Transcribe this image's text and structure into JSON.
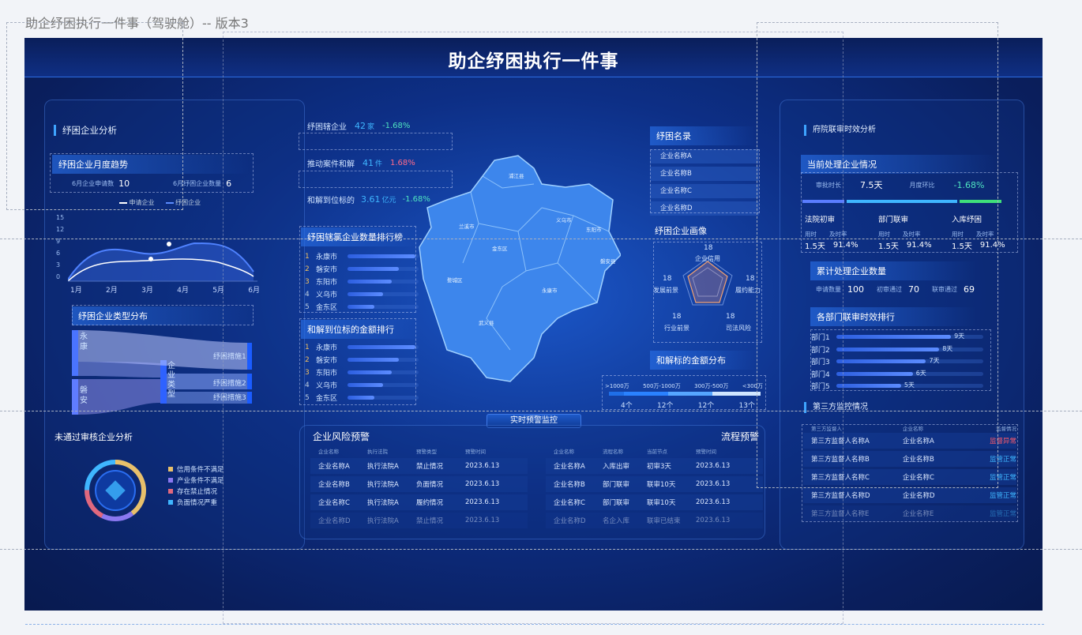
{
  "frame_label": "助企纾困执行一件事（驾驶舱）-- 版本3",
  "title": "助企纾困执行一件事",
  "left": {
    "section_title": "纾困企业分析",
    "monthly": {
      "title": "纾困企业月度趋势",
      "stat1_label": "6月企业申请数",
      "stat1_value": "10",
      "stat2_label": "6月纾困企业数量",
      "stat2_value": "6",
      "legend_apply": "申请企业",
      "legend_relief": "纾困企业",
      "y_ticks": [
        "15",
        "12",
        "9",
        "6",
        "3",
        "0"
      ],
      "months": [
        "1月",
        "2月",
        "3月",
        "4月",
        "5月",
        "6月"
      ]
    },
    "types": {
      "title": "纾困企业类型分布",
      "src1": "永康",
      "src2": "磐安",
      "mid": "企业类型",
      "t1": "纾困措施1",
      "t2": "纾困措施2",
      "t3": "纾困措施3"
    },
    "fail": {
      "title": "未通过审核企业分析",
      "legend": [
        "信用条件不满足",
        "产业条件不满足",
        "存在禁止情况",
        "负面情况严重"
      ],
      "colors": [
        "#e8c06b",
        "#8a78f0",
        "#e0687e",
        "#3fb6ff"
      ]
    }
  },
  "center": {
    "stats": [
      {
        "label": "纾困辖企业",
        "value": "42",
        "unit": "家",
        "change": "-1.68%",
        "change_color": "#4fe3c0"
      },
      {
        "label": "推动案件和解",
        "value": "41",
        "unit": "件",
        "change": "1.68%",
        "change_color": "#ff6b8a"
      },
      {
        "label": "和解到位标的",
        "value": "3.61",
        "unit": "亿元",
        "change": "-1.68%",
        "change_color": "#4fe3c0"
      }
    ],
    "rank1": {
      "title": "纾困辖氯企业数量排行榜",
      "items": [
        {
          "rank": "1",
          "name": "永康市",
          "pct": 0.95
        },
        {
          "rank": "2",
          "name": "磐安市",
          "pct": 0.72
        },
        {
          "rank": "3",
          "name": "东阳市",
          "pct": 0.62
        },
        {
          "rank": "4",
          "name": "义乌市",
          "pct": 0.5
        },
        {
          "rank": "5",
          "name": "金东区",
          "pct": 0.38
        }
      ]
    },
    "rank2": {
      "title": "和解到位标的金额排行",
      "items": [
        {
          "rank": "1",
          "name": "永康市",
          "pct": 0.95
        },
        {
          "rank": "2",
          "name": "磐安市",
          "pct": 0.72
        },
        {
          "rank": "3",
          "name": "东阳市",
          "pct": 0.62
        },
        {
          "rank": "4",
          "name": "义乌市",
          "pct": 0.5
        },
        {
          "rank": "5",
          "name": "金东区",
          "pct": 0.38
        }
      ]
    },
    "map_regions": [
      "浦江县",
      "兰溪市",
      "义乌市",
      "东阳市",
      "金东区",
      "婺城区",
      "磐安县",
      "武义县",
      "永康市"
    ],
    "list": {
      "title": "纾困名录",
      "items": [
        "企业名称A",
        "企业名称B",
        "企业名称C",
        "企业名称D"
      ]
    },
    "portrait": {
      "title": "纾困企业画像",
      "labels": [
        "企业信用",
        "履约能力",
        "司法风险",
        "行业前景",
        "发展前景"
      ],
      "values": [
        "18",
        "18",
        "18",
        "18",
        "18"
      ]
    },
    "dist": {
      "title": "和解标的金额分布",
      "labels": [
        ">1000万",
        "500万-1000万",
        "300万-500万",
        "<300万"
      ],
      "counts": [
        "4个",
        "12个",
        "12个",
        "13个"
      ]
    },
    "monitor_tab": "实时预警监控",
    "risk": {
      "title": "企业风险预警",
      "headers": [
        "企业名称",
        "执行法院",
        "预警类型",
        "预警时间"
      ],
      "rows": [
        [
          "企业名称A",
          "执行法院A",
          "禁止情况",
          "2023.6.13"
        ],
        [
          "企业名称B",
          "执行法院A",
          "负面情况",
          "2023.6.13"
        ],
        [
          "企业名称C",
          "执行法院A",
          "履约情况",
          "2023.6.13"
        ],
        [
          "企业名称D",
          "执行法院A",
          "禁止情况",
          "2023.6.13"
        ]
      ]
    },
    "flow": {
      "title": "流程预警",
      "headers": [
        "企业名称",
        "流程名称",
        "当前节点",
        "预警时间"
      ],
      "rows": [
        [
          "企业名称A",
          "入库出审",
          "初审3天",
          "2023.6.13"
        ],
        [
          "企业名称B",
          "部门联审",
          "联审10天",
          "2023.6.13"
        ],
        [
          "企业名称C",
          "部门联审",
          "联审10天",
          "2023.6.13"
        ],
        [
          "企业名称D",
          "名企入库",
          "联审已结束",
          "2023.6.13"
        ]
      ]
    }
  },
  "right": {
    "section_title": "府院联审时效分析",
    "current": {
      "title": "当前处理企业情况",
      "l1": "审批时长",
      "v1": "7.5天",
      "l2": "月度环比",
      "v2": "-1.68%"
    },
    "stages": [
      {
        "name": "法院初审",
        "t_label": "用时",
        "t": "1.5天",
        "r_label": "及时率",
        "r": "91.4%"
      },
      {
        "name": "部门联审",
        "t_label": "用时",
        "t": "1.5天",
        "r_label": "及时率",
        "r": "91.4%"
      },
      {
        "name": "入库纾困",
        "t_label": "用时",
        "t": "1.5天",
        "r_label": "及时率",
        "r": "91.4%"
      }
    ],
    "cumulative": {
      "title": "累计处理企业数量",
      "items": [
        {
          "label": "申请数量",
          "value": "100"
        },
        {
          "label": "初审通过",
          "value": "70"
        },
        {
          "label": "联审通过",
          "value": "69"
        }
      ]
    },
    "dept": {
      "title": "各部门联审时效排行",
      "items": [
        {
          "name": "部门1",
          "days": "9天",
          "pct": 0.78
        },
        {
          "name": "部门2",
          "days": "8天",
          "pct": 0.7
        },
        {
          "name": "部门3",
          "days": "7天",
          "pct": 0.61
        },
        {
          "name": "部门4",
          "days": "6天",
          "pct": 0.52
        },
        {
          "name": "部门5",
          "days": "5天",
          "pct": 0.44
        }
      ]
    },
    "third": {
      "title": "第三方监控情况",
      "headers": [
        "第三方监督人",
        "企业名称",
        "监督情况"
      ],
      "rows": [
        {
          "a": "第三方监督人名称A",
          "b": "企业名称A",
          "c": "监督异常",
          "color": "#ff5a6a"
        },
        {
          "a": "第三方监督人名称B",
          "b": "企业名称B",
          "c": "监管正常",
          "color": "#3fb6ff"
        },
        {
          "a": "第三方监督人名称C",
          "b": "企业名称C",
          "c": "监管正常",
          "color": "#3fb6ff"
        },
        {
          "a": "第三方监督人名称D",
          "b": "企业名称D",
          "c": "监管正常",
          "color": "#3fb6ff"
        },
        {
          "a": "第三方监督人名称E",
          "b": "企业名称E",
          "c": "监管正常",
          "color": "#3fb6ff"
        }
      ]
    }
  }
}
